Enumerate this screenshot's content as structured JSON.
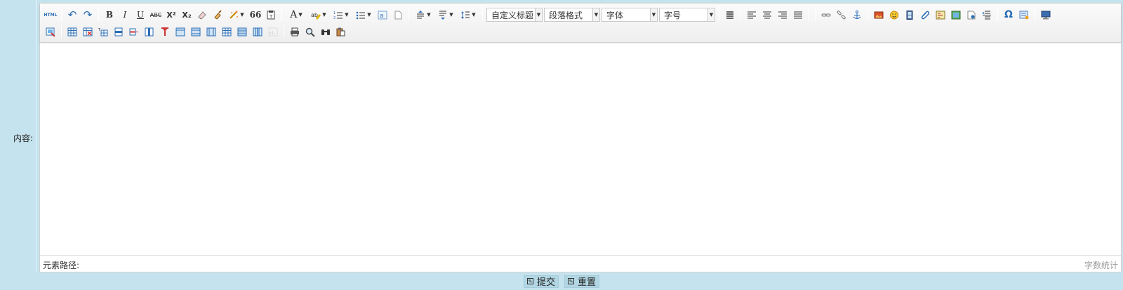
{
  "form": {
    "content_label": "内容:"
  },
  "editor": {
    "toolbar": {
      "html_label": "HTML",
      "bold_label": "B",
      "italic_label": "I",
      "underline_label": "U",
      "strike_label": "ABC",
      "superscript_label": "X²",
      "subscript_label": "X₂",
      "blockquote_label": "66",
      "fontcolor_label": "A",
      "omega_label": "Ω",
      "custom_heading": "自定义标题",
      "paragraph_format": "段落格式",
      "font_family": "字体",
      "font_size": "字号"
    },
    "content": "",
    "element_path_label": "元素路径:",
    "word_count_label": "字数统计"
  },
  "actions": {
    "submit_label": "提交",
    "reset_label": "重置"
  },
  "colors": {
    "page_bg": "#c5e3ee",
    "button_bg": "#b2d6e3",
    "icon_blue": "#2a6db5"
  }
}
